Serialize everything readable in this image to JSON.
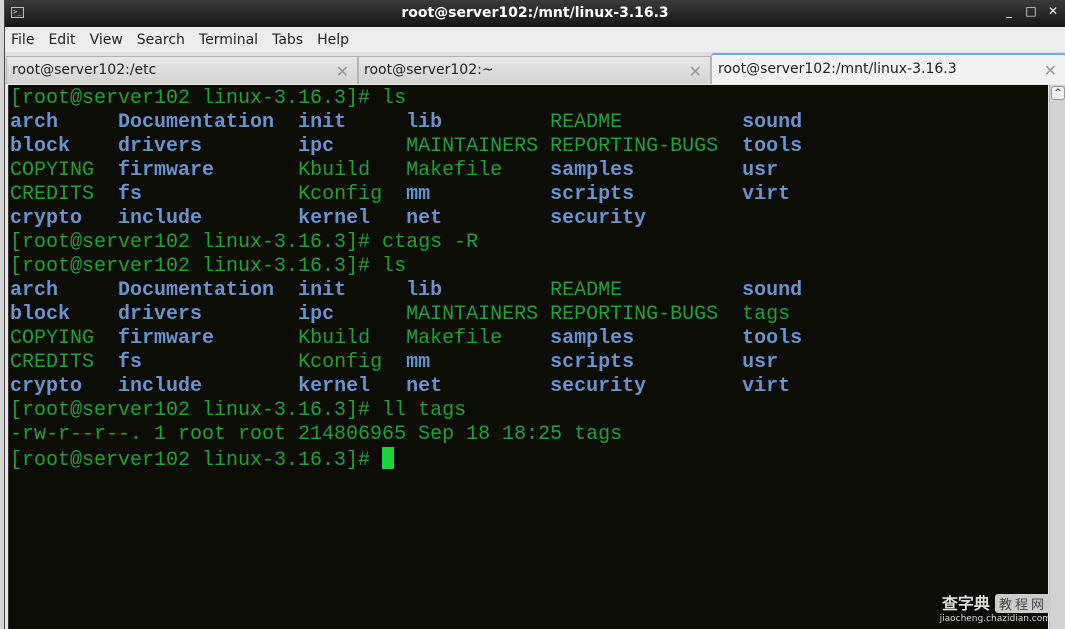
{
  "window": {
    "title": "root@server102:/mnt/linux-3.16.3",
    "controls": {
      "minimize": "_",
      "maximize": "□",
      "close": "✕"
    }
  },
  "menu": [
    "File",
    "Edit",
    "View",
    "Search",
    "Terminal",
    "Tabs",
    "Help"
  ],
  "tabs": [
    {
      "label": "root@server102:/etc",
      "close": "✕",
      "active": false
    },
    {
      "label": "root@server102:~",
      "close": "✕",
      "active": false
    },
    {
      "label": "root@server102:/mnt/linux-3.16.3",
      "close": "✕",
      "active": true
    }
  ],
  "colors": {
    "background": "#0b0c06",
    "prompt_green": "#1fa232",
    "dir_blue": "#6b93c9",
    "cursor": "#19d33a"
  },
  "terminal": {
    "lines": [
      {
        "type": "prompt",
        "text": "[root@server102 linux-3.16.3]# ls"
      },
      {
        "type": "ls",
        "cells": [
          [
            "arch",
            "b"
          ],
          [
            "Documentation",
            "b"
          ],
          [
            "init",
            "b"
          ],
          [
            "lib",
            "b"
          ],
          [
            "README",
            "g"
          ],
          [
            "sound",
            "b"
          ]
        ]
      },
      {
        "type": "ls",
        "cells": [
          [
            "block",
            "b"
          ],
          [
            "drivers",
            "b"
          ],
          [
            "ipc",
            "b"
          ],
          [
            "MAINTAINERS",
            "g"
          ],
          [
            "REPORTING-BUGS",
            "g"
          ],
          [
            "tools",
            "b"
          ]
        ]
      },
      {
        "type": "ls",
        "cells": [
          [
            "COPYING",
            "g"
          ],
          [
            "firmware",
            "b"
          ],
          [
            "Kbuild",
            "g"
          ],
          [
            "Makefile",
            "g"
          ],
          [
            "samples",
            "b"
          ],
          [
            "usr",
            "b"
          ]
        ]
      },
      {
        "type": "ls",
        "cells": [
          [
            "CREDITS",
            "g"
          ],
          [
            "fs",
            "b"
          ],
          [
            "Kconfig",
            "g"
          ],
          [
            "mm",
            "b"
          ],
          [
            "scripts",
            "b"
          ],
          [
            "virt",
            "b"
          ]
        ]
      },
      {
        "type": "ls",
        "cells": [
          [
            "crypto",
            "b"
          ],
          [
            "include",
            "b"
          ],
          [
            "kernel",
            "b"
          ],
          [
            "net",
            "b"
          ],
          [
            "security",
            "b"
          ],
          [
            "",
            ""
          ]
        ]
      },
      {
        "type": "prompt",
        "text": "[root@server102 linux-3.16.3]# ctags -R"
      },
      {
        "type": "prompt",
        "text": "[root@server102 linux-3.16.3]# ls"
      },
      {
        "type": "ls",
        "cells": [
          [
            "arch",
            "b"
          ],
          [
            "Documentation",
            "b"
          ],
          [
            "init",
            "b"
          ],
          [
            "lib",
            "b"
          ],
          [
            "README",
            "g"
          ],
          [
            "sound",
            "b"
          ]
        ]
      },
      {
        "type": "ls",
        "cells": [
          [
            "block",
            "b"
          ],
          [
            "drivers",
            "b"
          ],
          [
            "ipc",
            "b"
          ],
          [
            "MAINTAINERS",
            "g"
          ],
          [
            "REPORTING-BUGS",
            "g"
          ],
          [
            "tags",
            "g"
          ]
        ]
      },
      {
        "type": "ls",
        "cells": [
          [
            "COPYING",
            "g"
          ],
          [
            "firmware",
            "b"
          ],
          [
            "Kbuild",
            "g"
          ],
          [
            "Makefile",
            "g"
          ],
          [
            "samples",
            "b"
          ],
          [
            "tools",
            "b"
          ]
        ]
      },
      {
        "type": "ls",
        "cells": [
          [
            "CREDITS",
            "g"
          ],
          [
            "fs",
            "b"
          ],
          [
            "Kconfig",
            "g"
          ],
          [
            "mm",
            "b"
          ],
          [
            "scripts",
            "b"
          ],
          [
            "usr",
            "b"
          ]
        ]
      },
      {
        "type": "ls",
        "cells": [
          [
            "crypto",
            "b"
          ],
          [
            "include",
            "b"
          ],
          [
            "kernel",
            "b"
          ],
          [
            "net",
            "b"
          ],
          [
            "security",
            "b"
          ],
          [
            "virt",
            "b"
          ]
        ]
      },
      {
        "type": "prompt",
        "text": "[root@server102 linux-3.16.3]# ll tags"
      },
      {
        "type": "prompt",
        "text": "-rw-r--r--. 1 root root 214806965 Sep 18 18:25 tags"
      },
      {
        "type": "cursor",
        "text": "[root@server102 linux-3.16.3]# "
      }
    ]
  },
  "scrollbar": {
    "up_arrow": "^"
  },
  "watermark": {
    "main": "查字典",
    "box": "教程网",
    "url": "jiaocheng.chazidian.com"
  }
}
